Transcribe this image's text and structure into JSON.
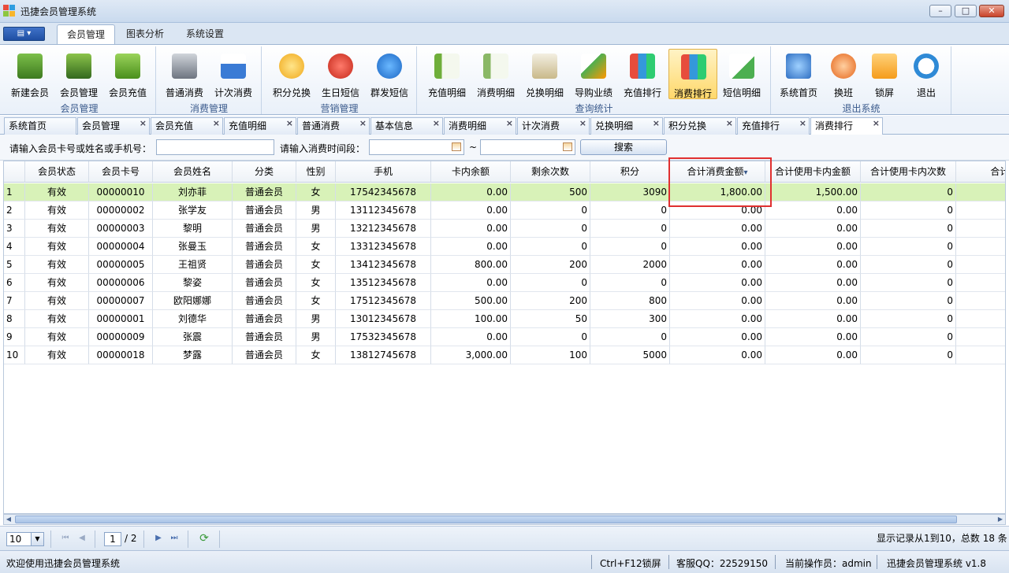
{
  "window": {
    "title": "迅捷会员管理系统"
  },
  "ribbon_tabs": [
    "会员管理",
    "图表分析",
    "系统设置"
  ],
  "ribbon_groups": [
    {
      "label": "会员管理",
      "buttons": [
        "新建会员",
        "会员管理",
        "会员充值"
      ]
    },
    {
      "label": "消费管理",
      "buttons": [
        "普通消费",
        "计次消费"
      ]
    },
    {
      "label": "营销管理",
      "buttons": [
        "积分兑换",
        "生日短信",
        "群发短信"
      ]
    },
    {
      "label": "查询统计",
      "buttons": [
        "充值明细",
        "消费明细",
        "兑换明细",
        "导购业绩",
        "充值排行",
        "消费排行",
        "短信明细"
      ]
    },
    {
      "label": "退出系统",
      "buttons": [
        "系统首页",
        "换班",
        "锁屏",
        "退出"
      ]
    }
  ],
  "doc_tabs": [
    "系统首页",
    "会员管理",
    "会员充值",
    "充值明细",
    "普通消费",
    "基本信息",
    "消费明细",
    "计次消费",
    "兑换明细",
    "积分兑换",
    "充值排行",
    "消费排行"
  ],
  "search": {
    "member_label": "请输入会员卡号或姓名或手机号：",
    "time_label": "请输入消费时间段：",
    "range_sep": "~",
    "button": "搜索"
  },
  "grid": {
    "columns": [
      "",
      "会员状态",
      "会员卡号",
      "会员姓名",
      "分类",
      "性别",
      "手机",
      "卡内余额",
      "剩余次数",
      "积分",
      "合计消费金额",
      "合计使用卡内金额",
      "合计使用卡内次数",
      "合计使用-"
    ],
    "sort_indicator": "▾",
    "rows": [
      [
        "1",
        "有效",
        "00000010",
        "刘亦菲",
        "普通会员",
        "女",
        "17542345678",
        "0.00",
        "500",
        "3090",
        "1,800.00",
        "1,500.00",
        "0",
        ""
      ],
      [
        "2",
        "有效",
        "00000002",
        "张学友",
        "普通会员",
        "男",
        "13112345678",
        "0.00",
        "0",
        "0",
        "0.00",
        "0.00",
        "0",
        ""
      ],
      [
        "3",
        "有效",
        "00000003",
        "黎明",
        "普通会员",
        "男",
        "13212345678",
        "0.00",
        "0",
        "0",
        "0.00",
        "0.00",
        "0",
        ""
      ],
      [
        "4",
        "有效",
        "00000004",
        "张曼玉",
        "普通会员",
        "女",
        "13312345678",
        "0.00",
        "0",
        "0",
        "0.00",
        "0.00",
        "0",
        ""
      ],
      [
        "5",
        "有效",
        "00000005",
        "王祖贤",
        "普通会员",
        "女",
        "13412345678",
        "800.00",
        "200",
        "2000",
        "0.00",
        "0.00",
        "0",
        ""
      ],
      [
        "6",
        "有效",
        "00000006",
        "黎姿",
        "普通会员",
        "女",
        "13512345678",
        "0.00",
        "0",
        "0",
        "0.00",
        "0.00",
        "0",
        ""
      ],
      [
        "7",
        "有效",
        "00000007",
        "欧阳娜娜",
        "普通会员",
        "女",
        "17512345678",
        "500.00",
        "200",
        "800",
        "0.00",
        "0.00",
        "0",
        ""
      ],
      [
        "8",
        "有效",
        "00000001",
        "刘德华",
        "普通会员",
        "男",
        "13012345678",
        "100.00",
        "50",
        "300",
        "0.00",
        "0.00",
        "0",
        ""
      ],
      [
        "9",
        "有效",
        "00000009",
        "张震",
        "普通会员",
        "男",
        "17532345678",
        "0.00",
        "0",
        "0",
        "0.00",
        "0.00",
        "0",
        ""
      ],
      [
        "10",
        "有效",
        "00000018",
        "梦露",
        "普通会员",
        "女",
        "13812745678",
        "3,000.00",
        "100",
        "5000",
        "0.00",
        "0.00",
        "0",
        ""
      ]
    ]
  },
  "pager": {
    "page_size": "10",
    "current_page": "1",
    "total_pages": "/ 2",
    "summary": "显示记录从1到10，总数 18 条"
  },
  "status": {
    "welcome": "欢迎使用迅捷会员管理系统",
    "hotkey": "Ctrl+F12锁屏",
    "qq": "客服QQ：22529150",
    "operator": "当前操作员：admin",
    "version": "迅捷会员管理系统 v1.8"
  }
}
